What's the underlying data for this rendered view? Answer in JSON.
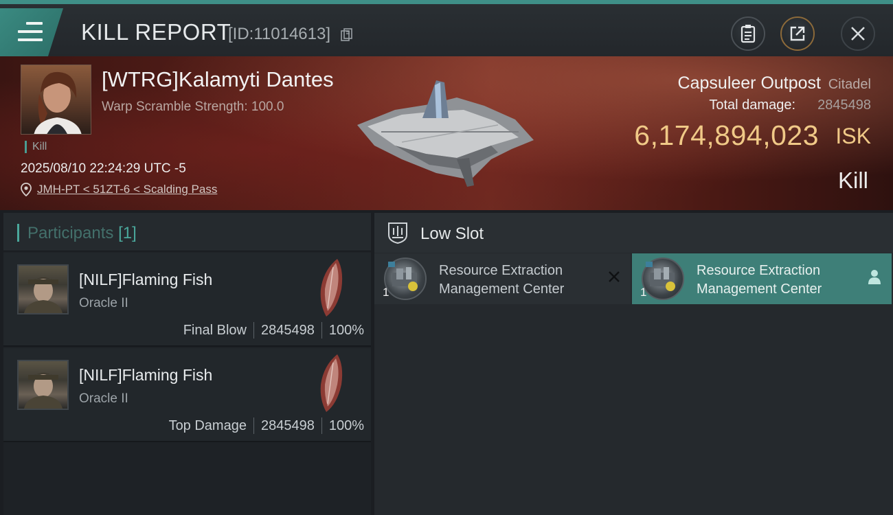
{
  "header": {
    "title": "KILL REPORT",
    "report_id": "[ID:11014613]"
  },
  "victim": {
    "name": "[WTRG]Kalamyti Dantes",
    "warp_scramble": "Warp Scramble Strength: 100.0",
    "kill_tag": "Kill",
    "timestamp": "2025/08/10 22:24:29 UTC -5",
    "location": "JMH-PT < 51ZT-6 < Scalding Pass"
  },
  "target": {
    "name": "Capsuleer Outpost",
    "type": "Citadel",
    "damage_label": "Total damage:",
    "damage_value": "2845498",
    "isk_value": "6,174,894,023",
    "isk_unit": "ISK",
    "result": "Kill"
  },
  "participants": {
    "label": "Participants",
    "count": "[1]",
    "items": [
      {
        "name": "[NILF]Flaming Fish",
        "ship": "Oracle II",
        "role": "Final Blow",
        "damage": "2845498",
        "percent": "100%"
      },
      {
        "name": "[NILF]Flaming Fish",
        "ship": "Oracle II",
        "role": "Top Damage",
        "damage": "2845498",
        "percent": "100%"
      }
    ]
  },
  "fitting": {
    "slot_title": "Low Slot",
    "modules": [
      {
        "qty": "1",
        "name_line1": "Resource Extraction",
        "name_line2": "Management Center",
        "status_icon": "destroyed-x-icon"
      },
      {
        "qty": "1",
        "name_line1": "Resource Extraction",
        "name_line2": "Management Center",
        "status_icon": "person-dropped-icon"
      }
    ]
  },
  "colors": {
    "accent": "#3f8f87",
    "isk": "#f0c987",
    "banner": "#5a1f19"
  }
}
